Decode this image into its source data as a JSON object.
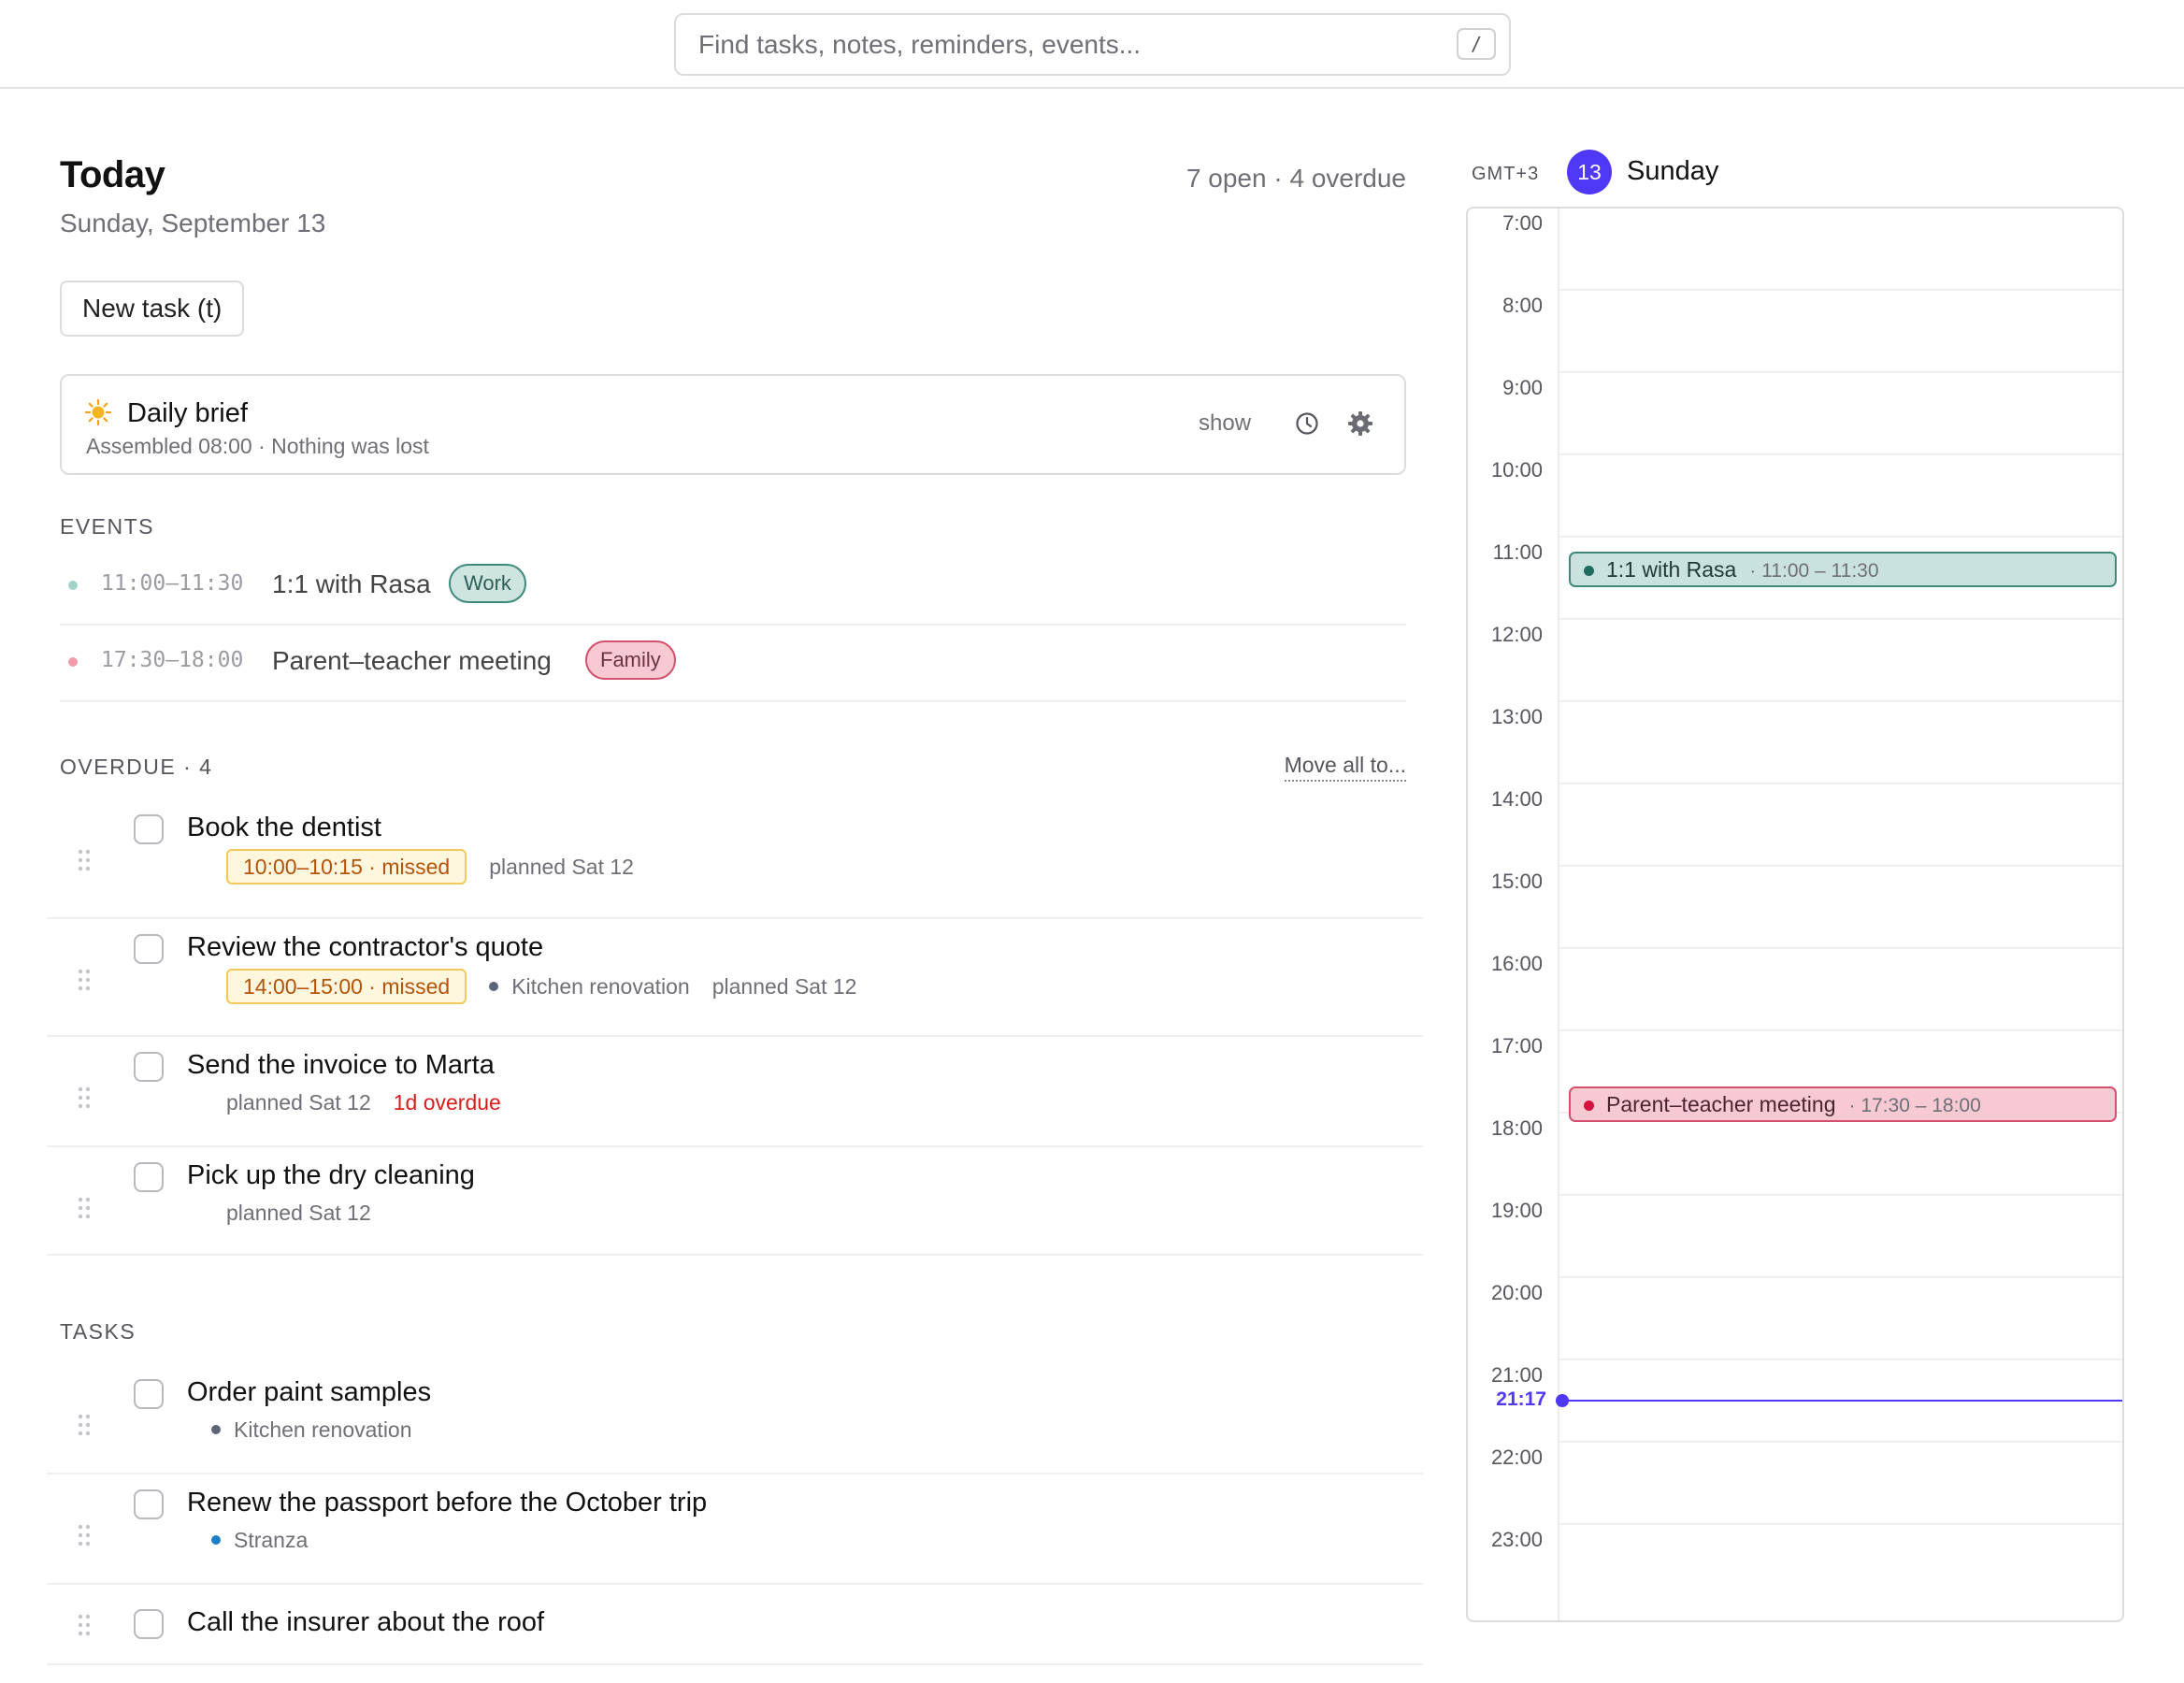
{
  "search": {
    "placeholder": "Find tasks, notes, reminders, events...",
    "shortcut": "/"
  },
  "header": {
    "title": "Today",
    "date": "Sunday, September 13",
    "summary": "7 open · 4 overdue",
    "new_task_label": "New task (t)"
  },
  "brief": {
    "icon": "sun-icon",
    "title": "Daily brief",
    "subtitle": "Assembled 08:00 · Nothing was lost",
    "show_label": "show"
  },
  "events": {
    "label": "EVENTS",
    "items": [
      {
        "time": "11:00–11:30",
        "name": "1:1 with Rasa",
        "tag": "Work",
        "color": "#9fd3c7"
      },
      {
        "time": "17:30–18:00",
        "name": "Parent–teacher meeting",
        "tag": "Family",
        "color": "#f29aab"
      }
    ]
  },
  "overdue": {
    "label": "OVERDUE · 4",
    "move_all_label": "Move all to...",
    "items": [
      {
        "title": "Book the dentist",
        "missed": "10:00–10:15 · missed",
        "project": "",
        "planned": "planned Sat 12",
        "overdue": ""
      },
      {
        "title": "Review the contractor's quote",
        "missed": "14:00–15:00 · missed",
        "project": "Kitchen renovation",
        "planned": "planned Sat 12",
        "overdue": ""
      },
      {
        "title": "Send the invoice to Marta",
        "missed": "",
        "project": "",
        "planned": "planned Sat 12",
        "overdue": "1d overdue"
      },
      {
        "title": "Pick up the dry cleaning",
        "missed": "",
        "project": "",
        "planned": "planned Sat 12",
        "overdue": ""
      }
    ]
  },
  "tasks": {
    "label": "TASKS",
    "items": [
      {
        "title": "Order paint samples",
        "project": "Kitchen renovation",
        "project_color": "#5b6478"
      },
      {
        "title": "Renew the passport before the October trip",
        "project": "Stranza",
        "project_color": "#1d7fc7"
      },
      {
        "title": "Call the insurer about the roof",
        "project": "",
        "project_color": ""
      }
    ]
  },
  "calendar": {
    "timezone": "GMT+3",
    "day_number": "13",
    "day_name": "Sunday",
    "hours": [
      "7:00",
      "8:00",
      "9:00",
      "10:00",
      "11:00",
      "12:00",
      "13:00",
      "14:00",
      "15:00",
      "16:00",
      "17:00",
      "18:00",
      "19:00",
      "20:00",
      "21:00",
      "22:00",
      "23:00"
    ],
    "events": [
      {
        "name": "1:1 with Rasa",
        "time": "· 11:00 – 11:30",
        "start": 11.0,
        "end": 11.5,
        "kind": "work",
        "dot": "#1f6b5e"
      },
      {
        "name": "Parent–teacher meeting",
        "time": "· 17:30 – 18:00",
        "start": 17.5,
        "end": 18.0,
        "kind": "family",
        "dot": "#d4143f"
      }
    ],
    "now_label": "21:17",
    "now": 21.2833,
    "accent": "#4f39f6"
  }
}
